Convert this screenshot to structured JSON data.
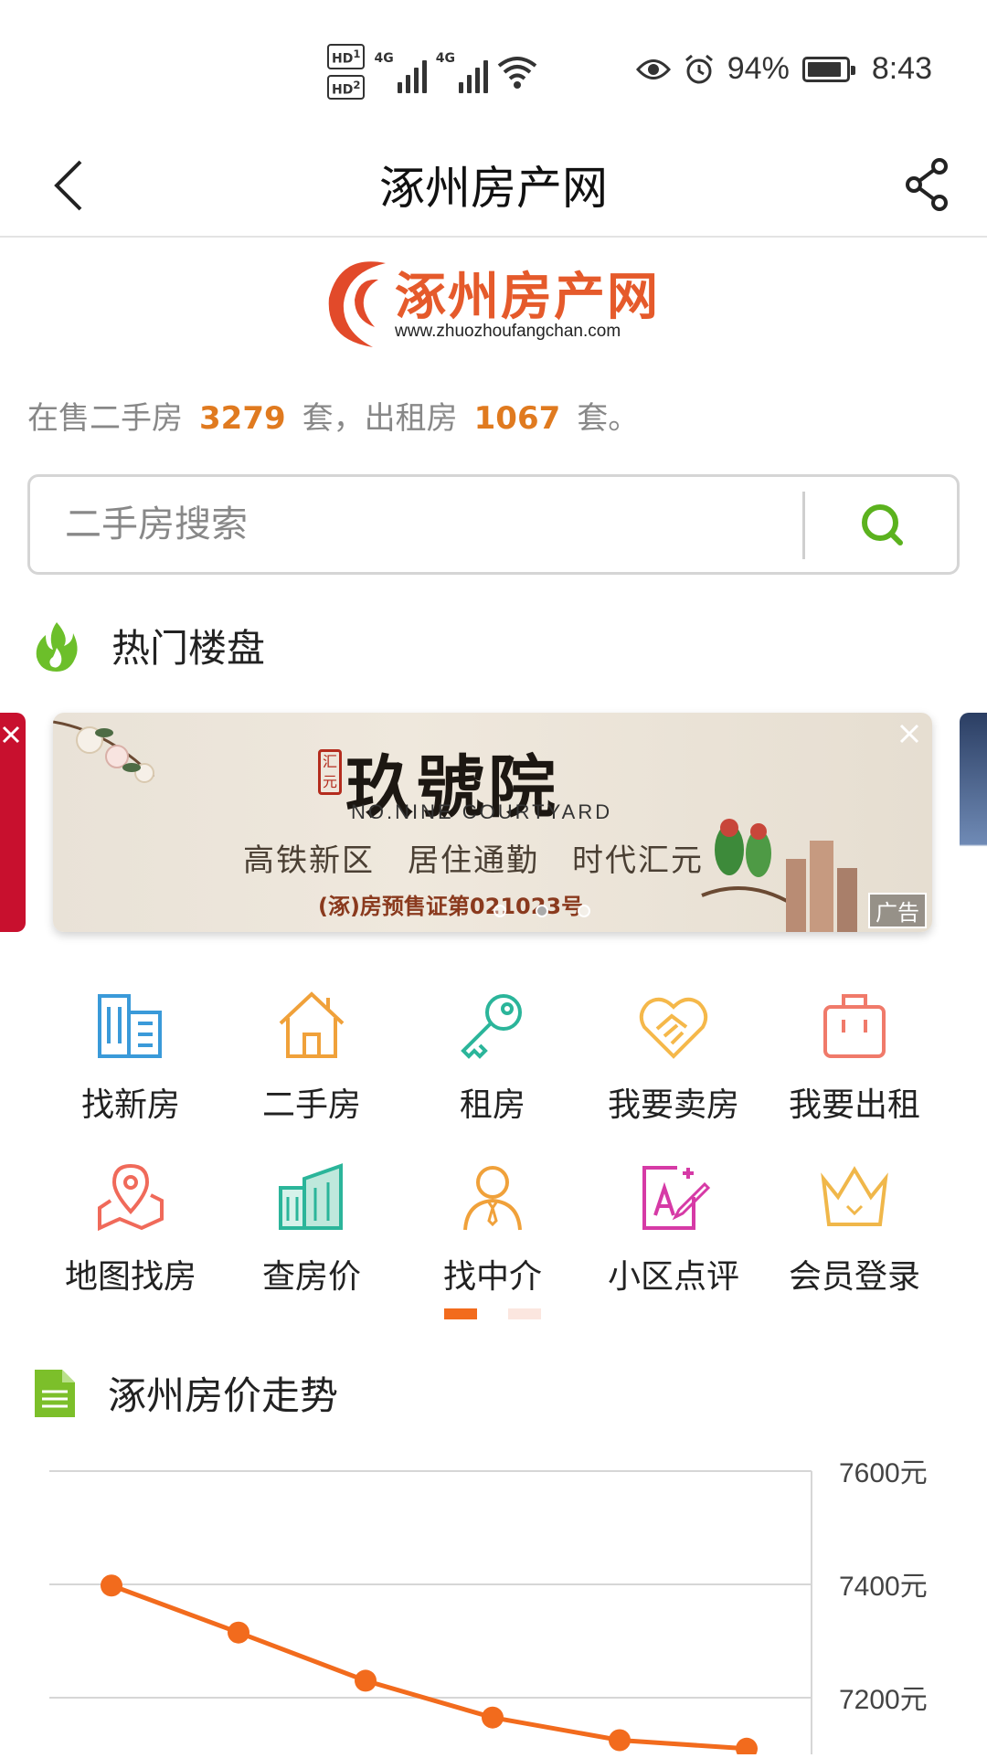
{
  "status_bar": {
    "hd1": "HD",
    "hd2": "HD",
    "sim1": "1",
    "sim2": "2",
    "net1": "4G",
    "net2": "4G",
    "battery_pct": "94%",
    "time": "8:43"
  },
  "nav": {
    "title": "涿州房产网"
  },
  "logo": {
    "name": "涿州房产网",
    "url": "www.zhuozhoufangchan.com"
  },
  "stats": {
    "prefix": "在售二手房",
    "sale_count": "3279",
    "mid": "套，出租房",
    "rent_count": "1067",
    "suffix": "套。"
  },
  "search": {
    "placeholder": "二手房搜索"
  },
  "hot": {
    "title": "热门楼盘"
  },
  "banner": {
    "seal": "汇元",
    "title": "玖號院",
    "en": "NO.NINE COURTYARD",
    "subtitle": "高铁新区　居住通勤　时代汇元",
    "license": "(涿)房预售证第021023号",
    "ad": "广告",
    "active_index": 1,
    "count": 3
  },
  "grid": [
    {
      "label": "找新房",
      "icon": "building-icon",
      "color": "#3a9ad9"
    },
    {
      "label": "二手房",
      "icon": "house-icon",
      "color": "#f0a13a"
    },
    {
      "label": "租房",
      "icon": "key-icon",
      "color": "#2bb59a"
    },
    {
      "label": "我要卖房",
      "icon": "handshake-icon",
      "color": "#f5b84a"
    },
    {
      "label": "我要出租",
      "icon": "suitcase-icon",
      "color": "#f07a6a"
    },
    {
      "label": "地图找房",
      "icon": "map-pin-icon",
      "color": "#f06a5a"
    },
    {
      "label": "查房价",
      "icon": "buildings-icon",
      "color": "#2bb59a"
    },
    {
      "label": "找中介",
      "icon": "agent-icon",
      "color": "#f0a13a"
    },
    {
      "label": "小区点评",
      "icon": "review-icon",
      "color": "#d63aa6"
    },
    {
      "label": "会员登录",
      "icon": "crown-icon",
      "color": "#f0b74a"
    }
  ],
  "grid_pager": {
    "active_index": 0,
    "count": 2
  },
  "trend": {
    "title": "涿州房价走势"
  },
  "chart_data": {
    "type": "line",
    "title": "",
    "xlabel": "",
    "ylabel": "",
    "y_ticks": [
      "7600元",
      "7400元",
      "7200元"
    ],
    "y_tick_values": [
      7600,
      7400,
      7200
    ],
    "ylim": [
      7200,
      7600
    ],
    "series": [
      {
        "values": [
          7398,
          7315,
          7230,
          7165,
          7125,
          7110
        ]
      }
    ],
    "color": "#f26b1d",
    "grid": true
  }
}
